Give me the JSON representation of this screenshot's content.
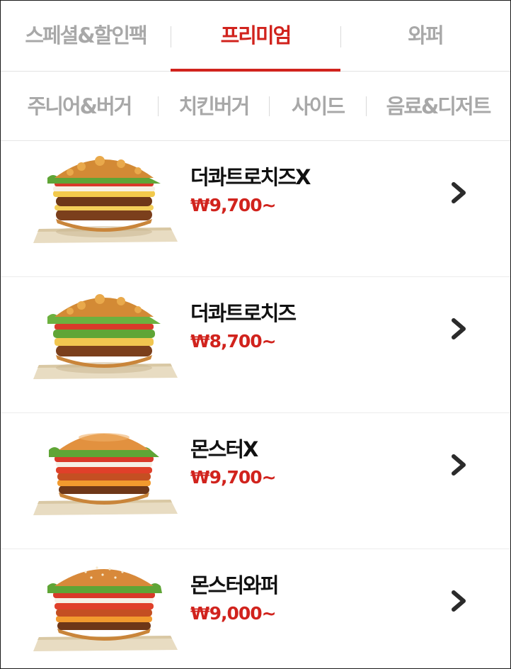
{
  "top_tabs": [
    {
      "label": "스페셜&할인팩",
      "active": false
    },
    {
      "label": "프리미엄",
      "active": true
    },
    {
      "label": "와퍼",
      "active": false
    }
  ],
  "sub_categories": [
    {
      "label": "주니어&버거"
    },
    {
      "label": "치킨버거"
    },
    {
      "label": "사이드"
    },
    {
      "label": "음료&디저트"
    }
  ],
  "products": [
    {
      "name": "더콰트로치즈X",
      "price": "₩9,700~",
      "icon": "chevron-right-icon"
    },
    {
      "name": "더콰트로치즈",
      "price": "₩8,700~",
      "icon": "chevron-right-icon"
    },
    {
      "name": "몬스터X",
      "price": "₩9,700~",
      "icon": "chevron-right-icon"
    },
    {
      "name": "몬스터와퍼",
      "price": "₩9,000~",
      "icon": "chevron-right-icon"
    }
  ],
  "colors": {
    "accent": "#d1231d",
    "inactive_text": "#a8a8a8",
    "text": "#111111"
  }
}
